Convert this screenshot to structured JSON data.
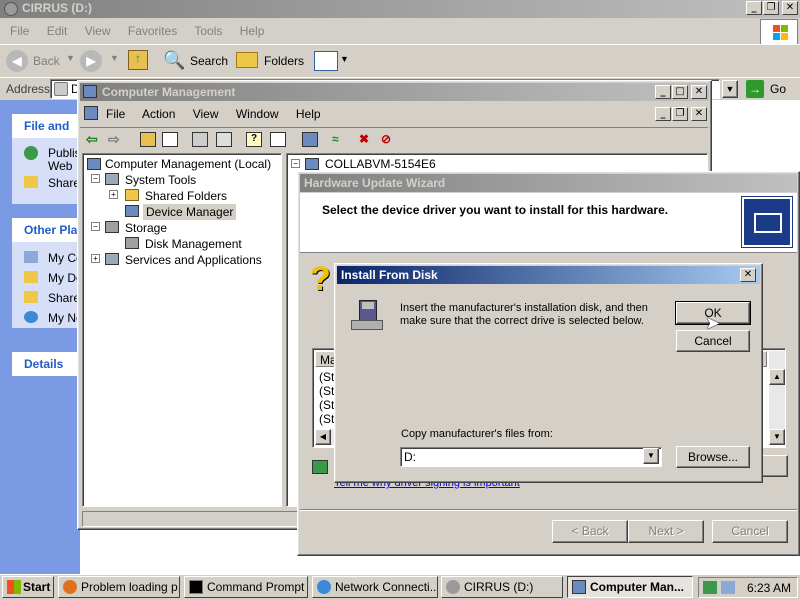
{
  "explorer": {
    "title": "CIRRUS (D:)",
    "menu": [
      "File",
      "Edit",
      "View",
      "Favorites",
      "Tools",
      "Help"
    ],
    "toolbar": {
      "back": "Back",
      "search": "Search",
      "folders": "Folders"
    },
    "address_label": "Address",
    "address_value": "D",
    "go_label": "Go",
    "tasks": {
      "file_and_folder": {
        "title": "File and",
        "items": [
          "Publis",
          "Web",
          "Share"
        ]
      },
      "other_places": {
        "title": "Other Pla",
        "items": [
          "My Co",
          "My Do",
          "Share",
          "My Ne"
        ]
      },
      "details": {
        "title": "Details"
      }
    }
  },
  "mgmt": {
    "title": "Computer Management",
    "menu": [
      "File",
      "Action",
      "View",
      "Window",
      "Help"
    ],
    "tree": {
      "root": "Computer Management (Local)",
      "system_tools": "System Tools",
      "shared_folders": "Shared Folders",
      "device_manager": "Device Manager",
      "storage": "Storage",
      "disk_management": "Disk Management",
      "services": "Services and Applications"
    },
    "right_header": "COLLABVM-5154E6"
  },
  "wizard": {
    "title": "Hardware Update Wizard",
    "heading": "Select the device driver you want to install for this hardware.",
    "list_header": "Ma",
    "list_rows": [
      "(St",
      "(St",
      "(St",
      "(St"
    ],
    "link_text": "Tell me why driver signing is important",
    "buttons": {
      "back": "< Back",
      "next": "Next >",
      "cancel": "Cancel"
    }
  },
  "dialog": {
    "title": "Install From Disk",
    "message": "Insert the manufacturer's installation disk, and then make sure that the correct drive is selected below.",
    "ok": "OK",
    "cancel": "Cancel",
    "copy_label": "Copy manufacturer's files from:",
    "copy_value": "D:",
    "browse": "Browse..."
  },
  "taskbar": {
    "start": "Start",
    "items": [
      "Problem loading p...",
      "Command Prompt",
      "Network Connecti...",
      "CIRRUS (D:)",
      "Computer Man..."
    ],
    "clock": "6:23 AM"
  },
  "colors": {
    "active_title": "#0a246a",
    "face": "#d4d0c8",
    "desktop_task": "#1f4fa3"
  }
}
